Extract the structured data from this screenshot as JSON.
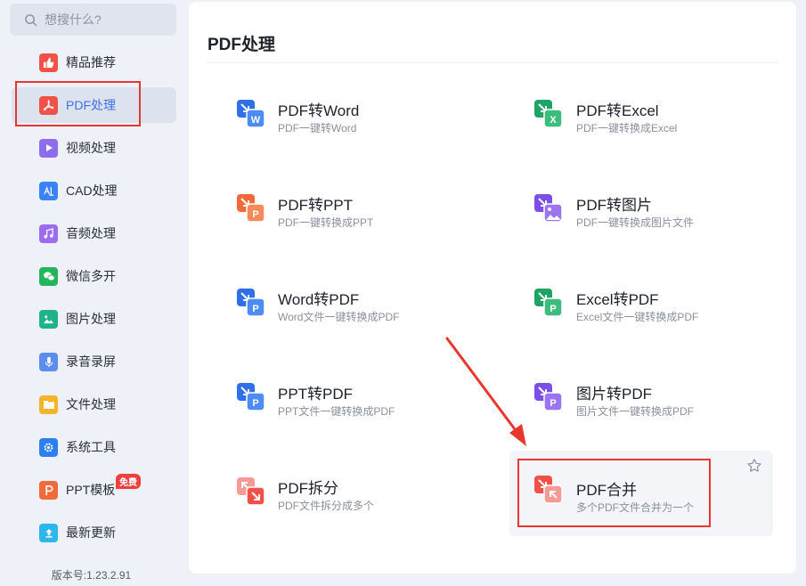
{
  "search": {
    "placeholder": "想搜什么?"
  },
  "sidebar": {
    "items": [
      {
        "label": "精品推荐",
        "icon": "thumbs-up-icon",
        "color": "#f0524a",
        "active": false
      },
      {
        "label": "PDF处理",
        "icon": "pdf-icon",
        "color": "#f0524a",
        "active": true
      },
      {
        "label": "视频处理",
        "icon": "video-play-icon",
        "color": "#8e6cf0",
        "active": false
      },
      {
        "label": "CAD处理",
        "icon": "cad-icon",
        "color": "#3b82f6",
        "active": false
      },
      {
        "label": "音频处理",
        "icon": "music-note-icon",
        "color": "#9b6bf0",
        "active": false
      },
      {
        "label": "微信多开",
        "icon": "wechat-icon",
        "color": "#22b55b",
        "active": false
      },
      {
        "label": "图片处理",
        "icon": "image-icon",
        "color": "#20b28a",
        "active": false
      },
      {
        "label": "录音录屏",
        "icon": "microphone-icon",
        "color": "#5b8def",
        "active": false
      },
      {
        "label": "文件处理",
        "icon": "folder-icon",
        "color": "#f5b52a",
        "active": false
      },
      {
        "label": "系统工具",
        "icon": "gear-icon",
        "color": "#2d7ff0",
        "active": false
      },
      {
        "label": "PPT模板",
        "icon": "ppt-icon",
        "color": "#f06a3a",
        "active": false,
        "badge": "免费"
      },
      {
        "label": "最新更新",
        "icon": "upload-icon",
        "color": "#2cb7e8",
        "active": false
      }
    ],
    "version": "版本号:1.23.2.91"
  },
  "main": {
    "title": "PDF处理",
    "tools": [
      {
        "title": "PDF转Word",
        "subtitle": "PDF一键转Word",
        "icon": "pdf-to-word-icon",
        "letter": "W",
        "color": "#2f6fe8"
      },
      {
        "title": "PDF转Excel",
        "subtitle": "PDF一键转换成Excel",
        "icon": "pdf-to-excel-icon",
        "letter": "X",
        "color": "#21a366"
      },
      {
        "title": "PDF转PPT",
        "subtitle": "PDF一键转换成PPT",
        "icon": "pdf-to-ppt-icon",
        "letter": "P",
        "color": "#f06a3a"
      },
      {
        "title": "PDF转图片",
        "subtitle": "PDF一键转换成图片文件",
        "icon": "pdf-to-image-icon",
        "letter": "",
        "color": "#7b4fe8"
      },
      {
        "title": "Word转PDF",
        "subtitle": "Word文件一键转换成PDF",
        "icon": "word-to-pdf-icon",
        "letter": "P",
        "color": "#2f6fe8"
      },
      {
        "title": "Excel转PDF",
        "subtitle": "Excel文件一键转换成PDF",
        "icon": "excel-to-pdf-icon",
        "letter": "P",
        "color": "#21a366"
      },
      {
        "title": "PPT转PDF",
        "subtitle": "PPT文件一键转换成PDF",
        "icon": "ppt-to-pdf-icon",
        "letter": "P",
        "color": "#2f6fe8"
      },
      {
        "title": "图片转PDF",
        "subtitle": "图片文件一键转换成PDF",
        "icon": "image-to-pdf-icon",
        "letter": "P",
        "color": "#7b4fe8"
      },
      {
        "title": "PDF拆分",
        "subtitle": "PDF文件拆分成多个",
        "icon": "pdf-split-icon",
        "letter": "",
        "color": "#f0524a"
      },
      {
        "title": "PDF合并",
        "subtitle": "多个PDF文件合并为一个",
        "icon": "pdf-merge-icon",
        "letter": "",
        "color": "#f0524a"
      }
    ]
  },
  "annotation_color": "#e8372f"
}
